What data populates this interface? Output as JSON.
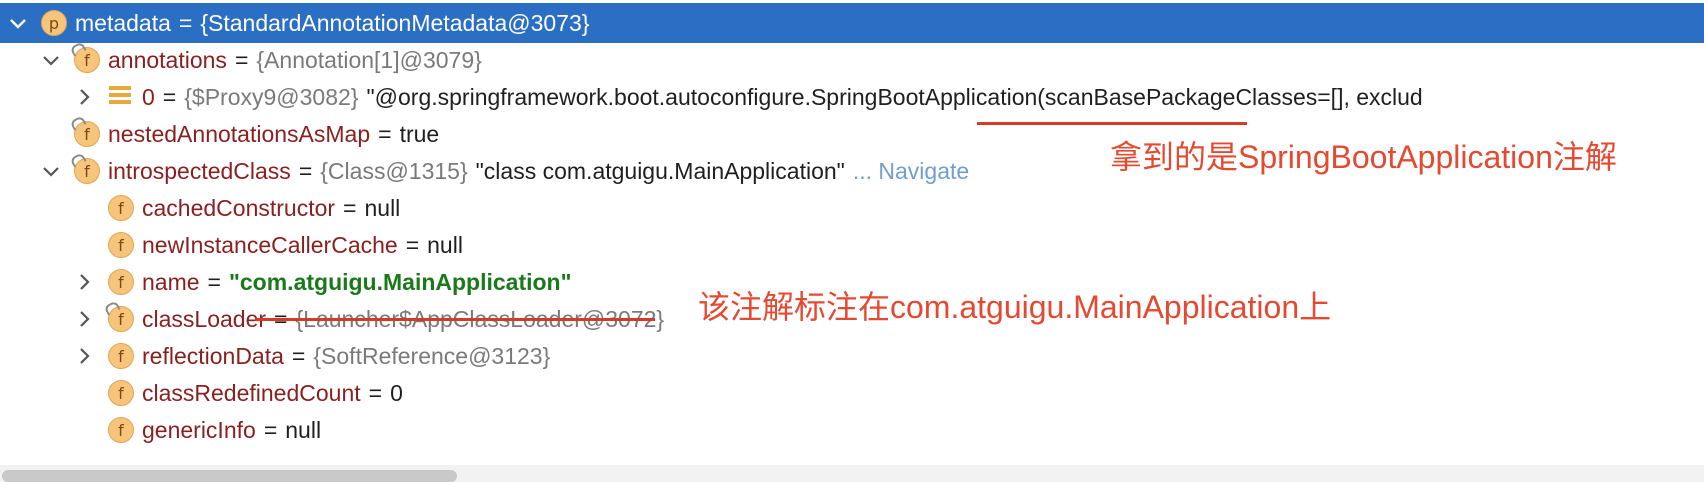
{
  "tree": {
    "rows": [
      {
        "name": "metadata",
        "ref": "{StandardAnnotationMetadata@3073}",
        "badge": "p"
      },
      {
        "name": "annotations",
        "ref": "{Annotation[1]@3079}",
        "badge": "f"
      },
      {
        "name": "0",
        "ref": "{$Proxy9@3082}",
        "value": "\"@org.springframework.boot.autoconfigure.SpringBootApplication(scanBasePackageClasses=[], exclud"
      },
      {
        "name": "nestedAnnotationsAsMap",
        "value": "true",
        "badge": "f"
      },
      {
        "name": "introspectedClass",
        "ref": "{Class@1315}",
        "value": "\"class com.atguigu.MainApplication\"",
        "extra": "... Navigate",
        "badge": "f"
      },
      {
        "name": "cachedConstructor",
        "value": "null",
        "badge": "f"
      },
      {
        "name": "newInstanceCallerCache",
        "value": "null",
        "badge": "f"
      },
      {
        "name": "name",
        "value": "\"com.atguigu.MainApplication\"",
        "badge": "f"
      },
      {
        "name": "classLoader",
        "ref": "{Launcher$AppClassLoader@3072}",
        "badge": "f"
      },
      {
        "name": "reflectionData",
        "ref": "{SoftReference@3123}",
        "badge": "f"
      },
      {
        "name": "classRedefinedCount",
        "value": "0",
        "badge": "f"
      },
      {
        "name": "genericInfo",
        "value": "null",
        "badge": "f"
      }
    ],
    "eq": "="
  },
  "annotations": {
    "note1": "拿到的是SpringBootApplication注解",
    "note2": "该注解标注在com.atguigu.MainApplication上"
  },
  "colors": {
    "selection": "#2a6fc4",
    "annotation": "#e44a32",
    "field_name": "#8a1f1f",
    "string_value": "#1a7a1a"
  }
}
